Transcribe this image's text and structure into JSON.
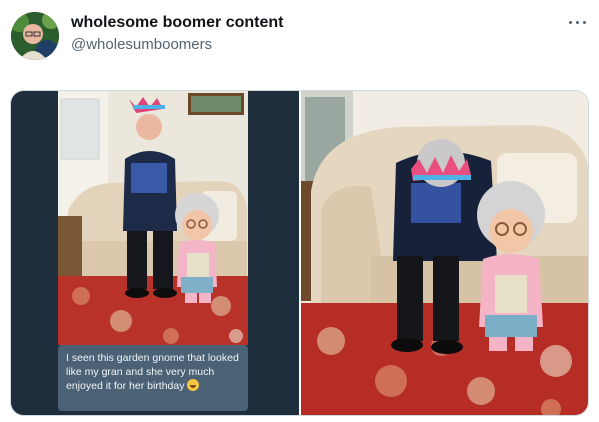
{
  "tweet": {
    "display_name": "wholesome boomer content",
    "handle": "@wholesumboomers",
    "more_icon": "more-horizontal-icon",
    "avatar_icon": "profile-avatar"
  },
  "media": {
    "caption_text": "I seen this garden gnome that looked like my gran and she very much enjoyed it for her birthday",
    "caption_emoji": "laughing-crying-emoji"
  },
  "colors": {
    "text_primary": "#0f1419",
    "text_secondary": "#536471",
    "border": "#cfd9de",
    "phone_bg": "#1e2e3d",
    "caption_bg": "#4b6175"
  }
}
